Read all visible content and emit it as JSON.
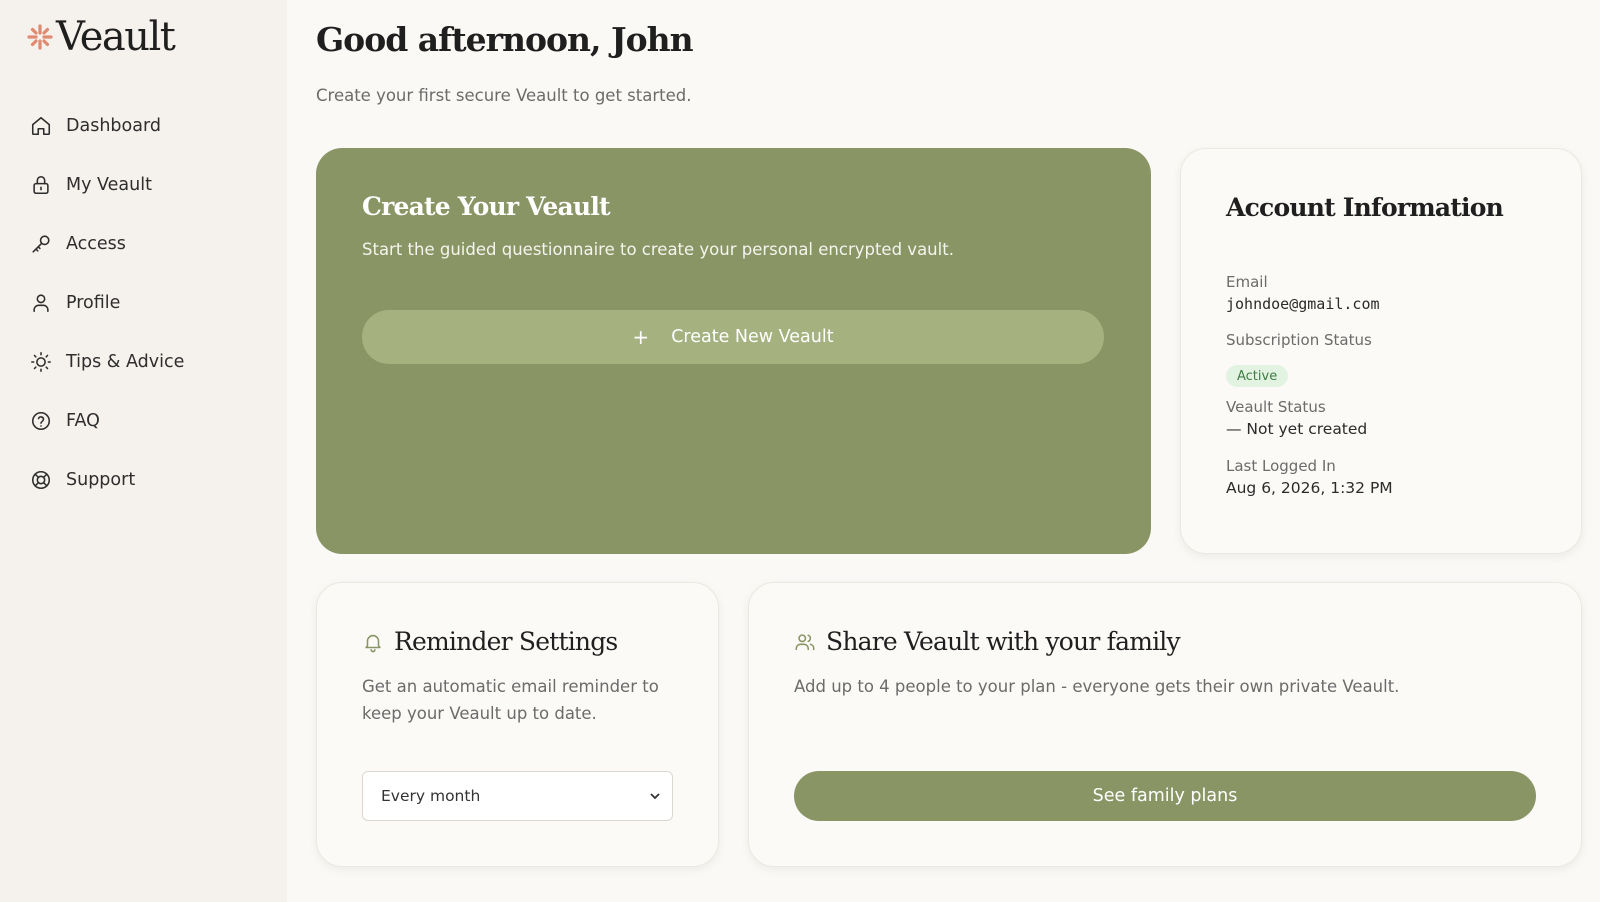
{
  "brand": {
    "name": "Veault",
    "accent": "#e08a72"
  },
  "sidebar": {
    "items": [
      {
        "label": "Dashboard",
        "icon": "home-icon"
      },
      {
        "label": "My Veault",
        "icon": "lock-icon"
      },
      {
        "label": "Access",
        "icon": "key-icon"
      },
      {
        "label": "Profile",
        "icon": "user-icon"
      },
      {
        "label": "Tips & Advice",
        "icon": "lightbulb-icon"
      },
      {
        "label": "FAQ",
        "icon": "help-circle-icon"
      },
      {
        "label": "Support",
        "icon": "lifebuoy-icon"
      }
    ]
  },
  "header": {
    "greeting": "Good afternoon, John",
    "subtitle": "Create your first secure Veault to get started."
  },
  "create_card": {
    "title": "Create Your Veault",
    "description": "Start the guided questionnaire to create your personal encrypted vault.",
    "button_icon": "+",
    "button_label": "Create New Veault",
    "color": "#8a9565"
  },
  "account": {
    "title": "Account Information",
    "email_label": "Email",
    "email_value": "johndoe@gmail.com",
    "subscription_label": "Subscription Status",
    "subscription_value": "Active",
    "veault_status_label": "Veault Status",
    "veault_status_value": "— Not yet created",
    "last_login_label": "Last Logged In",
    "last_login_value": "Aug 6, 2026, 1:32 PM"
  },
  "reminder": {
    "title": "Reminder Settings",
    "icon": "bell-icon",
    "description_line1": "Get an automatic email reminder to",
    "description_line2": "keep your Veault up to date.",
    "selected": "Every month"
  },
  "family": {
    "title": "Share Veault with your family",
    "icon": "users-icon",
    "description": "Add up to 4 people to your plan - everyone gets their own private Veault.",
    "button_label": "See family plans"
  }
}
